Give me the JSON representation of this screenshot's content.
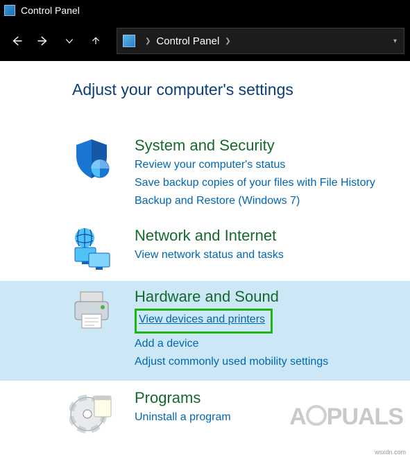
{
  "window": {
    "title": "Control Panel"
  },
  "address": {
    "crumb": "Control Panel"
  },
  "page": {
    "header": "Adjust your computer's settings"
  },
  "categories": {
    "system": {
      "title": "System and Security",
      "links": [
        "Review your computer's status",
        "Save backup copies of your files with File History",
        "Backup and Restore (Windows 7)"
      ]
    },
    "network": {
      "title": "Network and Internet",
      "links": [
        "View network status and tasks"
      ]
    },
    "hardware": {
      "title": "Hardware and Sound",
      "highlighted_link": "View devices and printers",
      "links": [
        "Add a device",
        "Adjust commonly used mobility settings"
      ]
    },
    "programs": {
      "title": "Programs",
      "links": [
        "Uninstall a program"
      ]
    }
  },
  "attribution": "wsxdn.com",
  "watermark": "A  PUALS"
}
